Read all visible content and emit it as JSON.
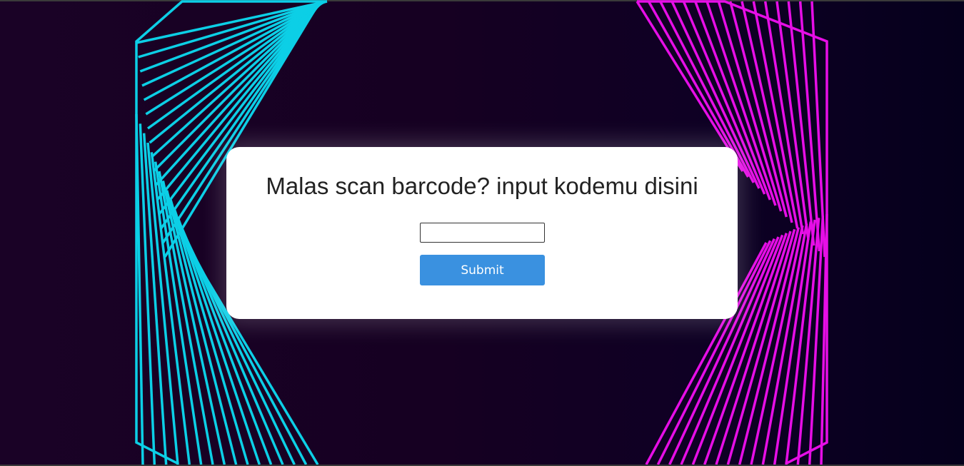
{
  "form": {
    "heading": "Malas scan barcode? input kodemu disini",
    "code_input_value": "",
    "submit_label": "Submit"
  },
  "colors": {
    "background": "#160020",
    "left_art": "#0ccfe6",
    "right_art": "#e60ee6",
    "submit_button": "#3a91e0",
    "card": "#ffffff"
  }
}
